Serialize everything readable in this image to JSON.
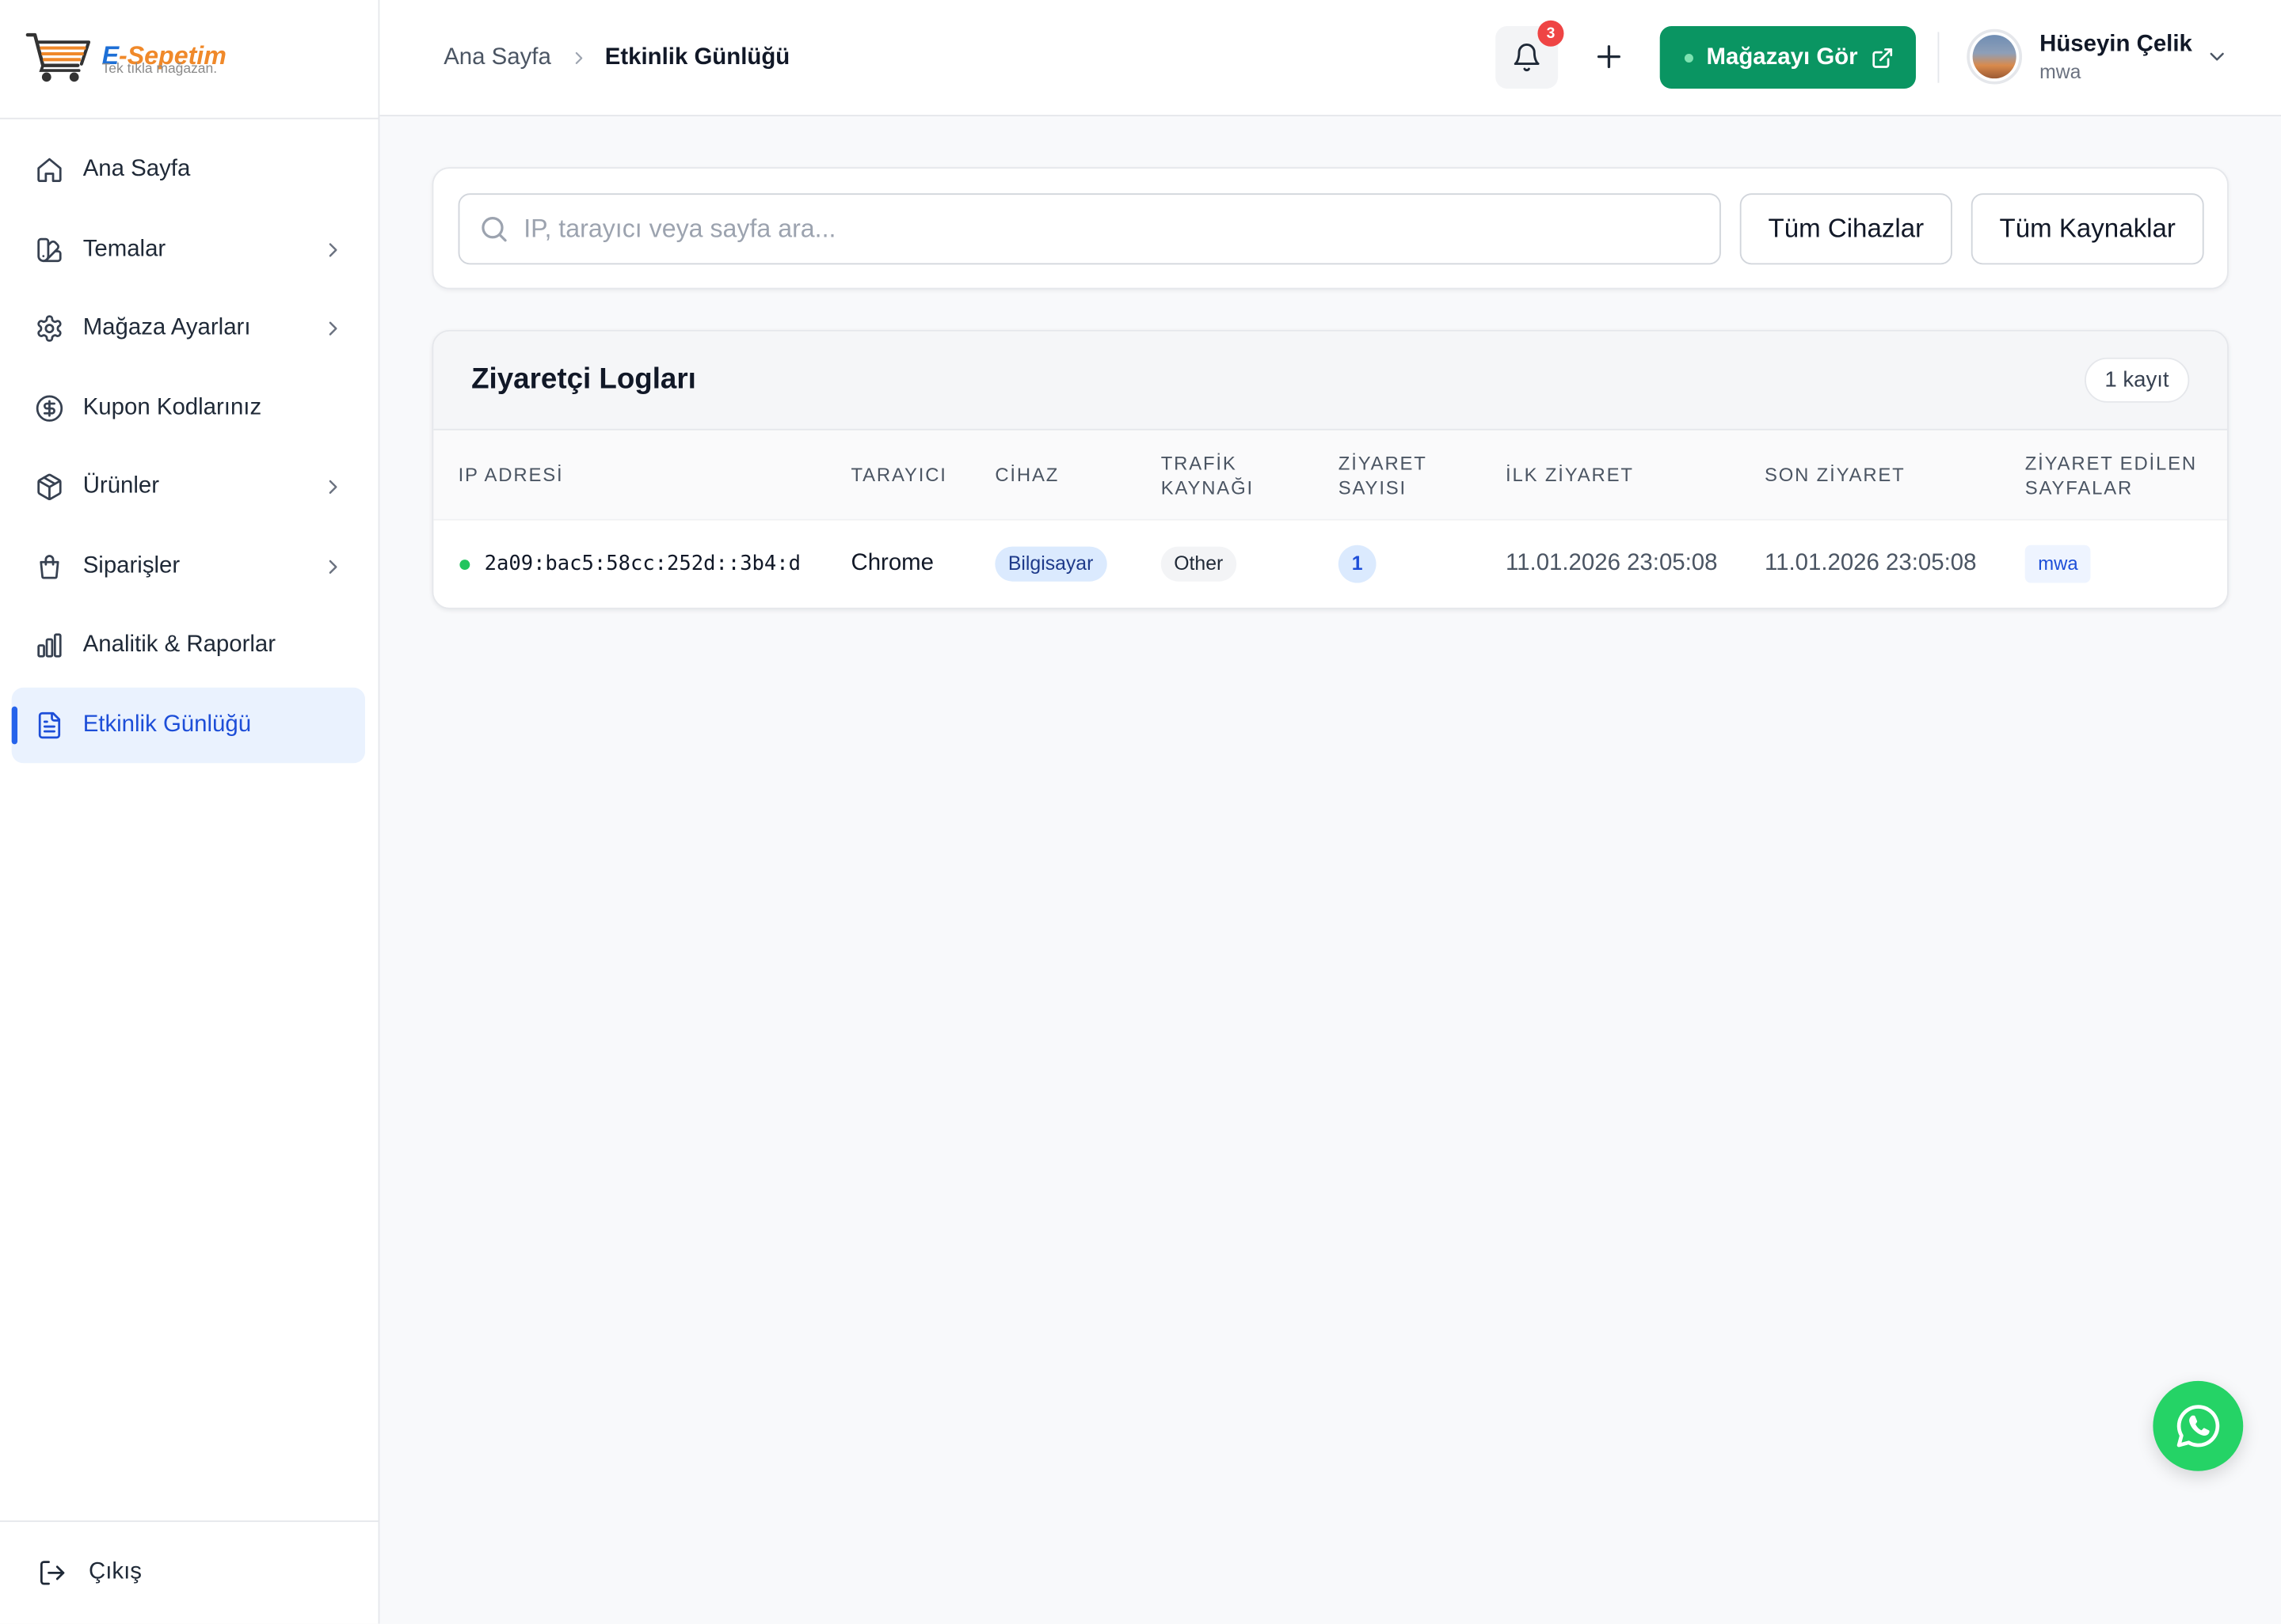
{
  "logo": {
    "brand_prefix": "E",
    "brand_suffix": "-Sepetim",
    "tagline": "Tek tıkla mağazan."
  },
  "sidebar": {
    "items": [
      {
        "label": "Ana Sayfa",
        "icon": "home-icon",
        "has_submenu": false,
        "active": false
      },
      {
        "label": "Temalar",
        "icon": "swatch-book-icon",
        "has_submenu": true,
        "active": false
      },
      {
        "label": "Mağaza Ayarları",
        "icon": "gear-icon",
        "has_submenu": true,
        "active": false
      },
      {
        "label": "Kupon Kodlarınız",
        "icon": "dollar-circle-icon",
        "has_submenu": false,
        "active": false
      },
      {
        "label": "Ürünler",
        "icon": "package-icon",
        "has_submenu": true,
        "active": false
      },
      {
        "label": "Siparişler",
        "icon": "shopping-bag-icon",
        "has_submenu": true,
        "active": false
      },
      {
        "label": "Analitik & Raporlar",
        "icon": "bar-chart-icon",
        "has_submenu": false,
        "active": false
      },
      {
        "label": "Etkinlik Günlüğü",
        "icon": "file-text-icon",
        "has_submenu": false,
        "active": true
      }
    ],
    "logout_label": "Çıkış"
  },
  "header": {
    "breadcrumb": [
      "Ana Sayfa",
      "Etkinlik Günlüğü"
    ],
    "notification_count": "3",
    "store_button_label": "Mağazayı Gör",
    "user": {
      "name": "Hüseyin Çelik",
      "store": "mwa"
    }
  },
  "filters": {
    "search_placeholder": "IP, tarayıcı veya sayfa ara...",
    "device_filter": "Tüm Cihazlar",
    "source_filter": "Tüm Kaynaklar"
  },
  "table": {
    "title": "Ziyaretçi Logları",
    "count_label": "1 kayıt",
    "columns": [
      "IP ADRESİ",
      "TARAYICI",
      "CİHAZ",
      "TRAFİK KAYNAĞI",
      "ZİYARET SAYISI",
      "İLK ZİYARET",
      "SON ZİYARET",
      "ZİYARET EDİLEN SAYFALAR"
    ],
    "rows": [
      {
        "ip": "2a09:bac5:58cc:252d::3b4:d",
        "online": true,
        "browser": "Chrome",
        "device": "Bilgisayar",
        "source": "Other",
        "visits": "1",
        "first_visit": "11.01.2026 23:05:08",
        "last_visit": "11.01.2026 23:05:08",
        "pages": [
          "mwa"
        ]
      }
    ]
  },
  "colors": {
    "accent": "#2563eb",
    "active_bg": "#eaf2fe",
    "store_button": "#0a9562",
    "notification_badge": "#ef4444",
    "whatsapp": "#25d366",
    "online_dot": "#22c55e",
    "brand_blue": "#1d6fd6",
    "brand_orange": "#f0892a"
  },
  "fab": {
    "icon": "whatsapp-icon"
  }
}
